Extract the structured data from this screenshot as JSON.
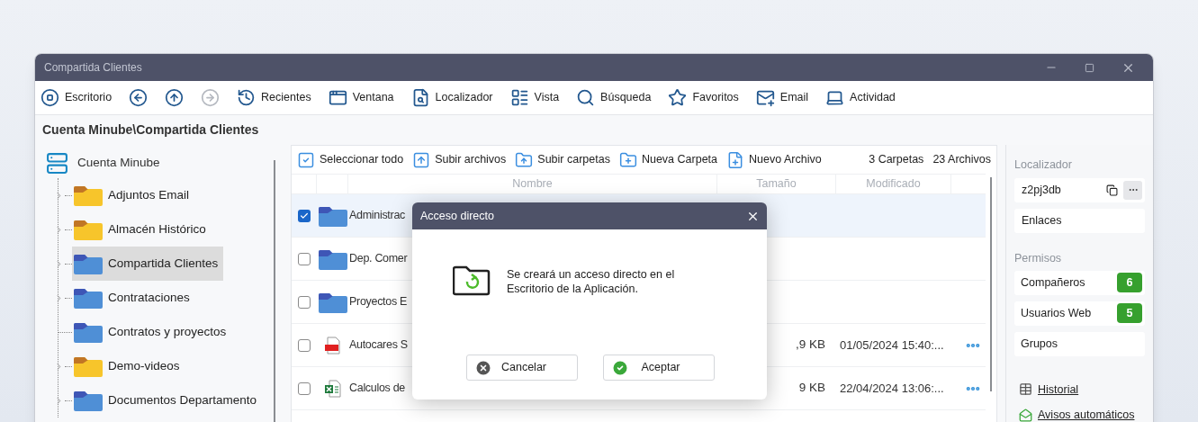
{
  "window": {
    "title": "Compartida Clientes"
  },
  "toolbar": [
    {
      "kind": "labeled",
      "label": "Escritorio",
      "disabled": false
    },
    {
      "kind": "nav",
      "disabled": false
    },
    {
      "kind": "nav",
      "disabled": false
    },
    {
      "kind": "nav",
      "disabled": true
    },
    {
      "kind": "labeled",
      "label": "Recientes",
      "disabled": false
    },
    {
      "kind": "labeled",
      "label": "Ventana",
      "disabled": false
    },
    {
      "kind": "labeled",
      "label": "Localizador",
      "disabled": false
    },
    {
      "kind": "labeled",
      "label": "Vista",
      "disabled": false
    },
    {
      "kind": "labeled",
      "label": "Búsqueda",
      "disabled": false
    },
    {
      "kind": "labeled",
      "label": "Favoritos",
      "disabled": false
    },
    {
      "kind": "labeled",
      "label": "Email",
      "disabled": false
    },
    {
      "kind": "labeled",
      "label": "Actividad",
      "disabled": false
    }
  ],
  "breadcrumb": "Cuenta Minube\\Compartida Clientes",
  "tree": {
    "root": "Cuenta Minube",
    "items": [
      {
        "label": "Adjuntos Email",
        "color": "#f7c52b",
        "expandable": true,
        "selected": false
      },
      {
        "label": "Almacén Histórico",
        "color": "#f7c52b",
        "expandable": true,
        "selected": false
      },
      {
        "label": "Compartida Clientes",
        "color": "#4f8fd6",
        "expandable": true,
        "selected": true
      },
      {
        "label": "Contrataciones",
        "color": "#4f8fd6",
        "expandable": true,
        "selected": false
      },
      {
        "label": "Contratos y proyectos",
        "color": "#4f8fd6",
        "expandable": false,
        "selected": false
      },
      {
        "label": "Demo-videos",
        "color": "#f7c52b",
        "expandable": true,
        "selected": false
      },
      {
        "label": "Documentos Departamento",
        "color": "#4f8fd6",
        "expandable": true,
        "selected": false
      }
    ]
  },
  "file_toolbar": {
    "actions": [
      "Seleccionar todo",
      "Subir archivos",
      "Subir carpetas",
      "Nueva Carpeta",
      "Nuevo Archivo"
    ],
    "folders": "3 Carpetas",
    "files": "23 Archivos"
  },
  "table": {
    "columns": [
      "Nombre",
      "Tamaño",
      "Modificado"
    ],
    "rows": [
      {
        "kind": "folder",
        "name": "Administrac",
        "checked": true,
        "selected": true
      },
      {
        "kind": "folder",
        "name": "Dep. Comer",
        "checked": false,
        "selected": false
      },
      {
        "kind": "folder",
        "name": "Proyectos E",
        "checked": false,
        "selected": false
      },
      {
        "kind": "pdf",
        "name": "Autocares S",
        "size": ",9 KB",
        "modified": "01/05/2024 15:40:...",
        "checked": false,
        "selected": false
      },
      {
        "kind": "xlsx",
        "name": "Calculos de",
        "size": "9 KB",
        "modified": "22/04/2024 13:06:...",
        "checked": false,
        "selected": false
      }
    ]
  },
  "right_panel": {
    "locator_label": "Localizador",
    "locator_value": "z2pj3db",
    "links_label": "Enlaces",
    "permissions_label": "Permisos",
    "permissions": [
      {
        "label": "Compañeros",
        "count": "6"
      },
      {
        "label": "Usuarios Web",
        "count": "5"
      },
      {
        "label": "Grupos"
      }
    ],
    "footer_links": [
      "Historial",
      "Avisos automáticos"
    ]
  },
  "dialog": {
    "title": "Acceso directo",
    "message": "Se creará un acceso directo en el Escritorio de la Aplicación.",
    "buttons": [
      {
        "kind": "cancel",
        "label": "Cancelar"
      },
      {
        "kind": "accept",
        "label": "Aceptar"
      }
    ]
  }
}
